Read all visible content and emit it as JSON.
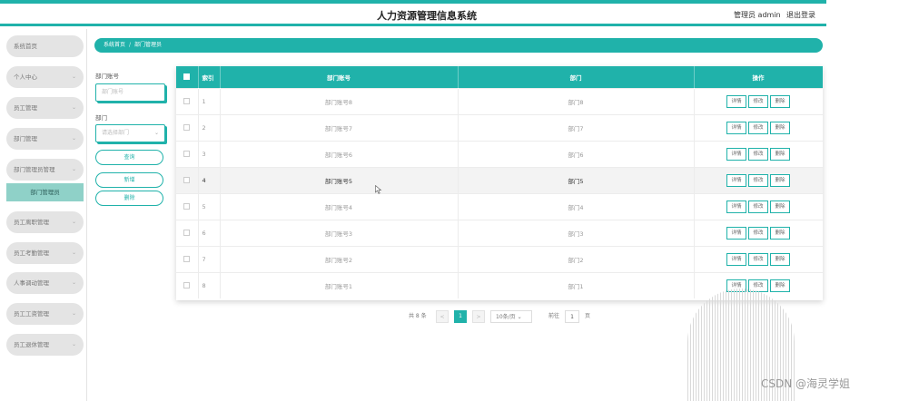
{
  "header": {
    "title": "人力资源管理信息系统",
    "admin": "管理员 admin",
    "logout": "退出登录",
    "accent_color": "#20b2aa"
  },
  "sidebar": {
    "items": [
      {
        "label": "系统首页",
        "has_arrow": false
      },
      {
        "label": "个人中心",
        "has_arrow": true
      },
      {
        "label": "员工管理",
        "has_arrow": true
      },
      {
        "label": "部门管理",
        "has_arrow": true
      },
      {
        "label": "部门管理员管理",
        "has_arrow": true
      },
      {
        "label": "员工离职管理",
        "has_arrow": true
      },
      {
        "label": "员工考勤管理",
        "has_arrow": true
      },
      {
        "label": "人事调动管理",
        "has_arrow": true
      },
      {
        "label": "员工工资管理",
        "has_arrow": true
      },
      {
        "label": "员工退休管理",
        "has_arrow": true
      }
    ],
    "active_sub": "部门管理员",
    "arrow_icon": "chevron-down-icon"
  },
  "breadcrumb": {
    "home": "系统首页",
    "separator": "/",
    "current": "部门管理员"
  },
  "filters": {
    "account_label": "部门账号",
    "account_placeholder": "部门账号",
    "dept_label": "部门",
    "dept_placeholder": "请选择部门",
    "search": "查询",
    "add": "新增",
    "delete": "删除"
  },
  "table": {
    "headers": {
      "index": "索引",
      "account": "部门账号",
      "dept": "部门",
      "ops": "操作"
    },
    "rows": [
      {
        "index": "1",
        "account": "部门账号8",
        "dept": "部门8"
      },
      {
        "index": "2",
        "account": "部门账号7",
        "dept": "部门7"
      },
      {
        "index": "3",
        "account": "部门账号6",
        "dept": "部门6"
      },
      {
        "index": "4",
        "account": "部门账号5",
        "dept": "部门5"
      },
      {
        "index": "5",
        "account": "部门账号4",
        "dept": "部门4"
      },
      {
        "index": "6",
        "account": "部门账号3",
        "dept": "部门3"
      },
      {
        "index": "7",
        "account": "部门账号2",
        "dept": "部门2"
      },
      {
        "index": "8",
        "account": "部门账号1",
        "dept": "部门1"
      }
    ],
    "highlighted_row_index": 3,
    "actions": {
      "detail": "详情",
      "edit": "修改",
      "delete": "删除"
    }
  },
  "pagination": {
    "total": "共 8 条",
    "prev": "<",
    "current_page": "1",
    "next": ">",
    "page_size": "10条/页",
    "goto_label": "前往",
    "goto_value": "1",
    "page_unit": "页"
  },
  "watermark": "CSDN @海灵学姐"
}
